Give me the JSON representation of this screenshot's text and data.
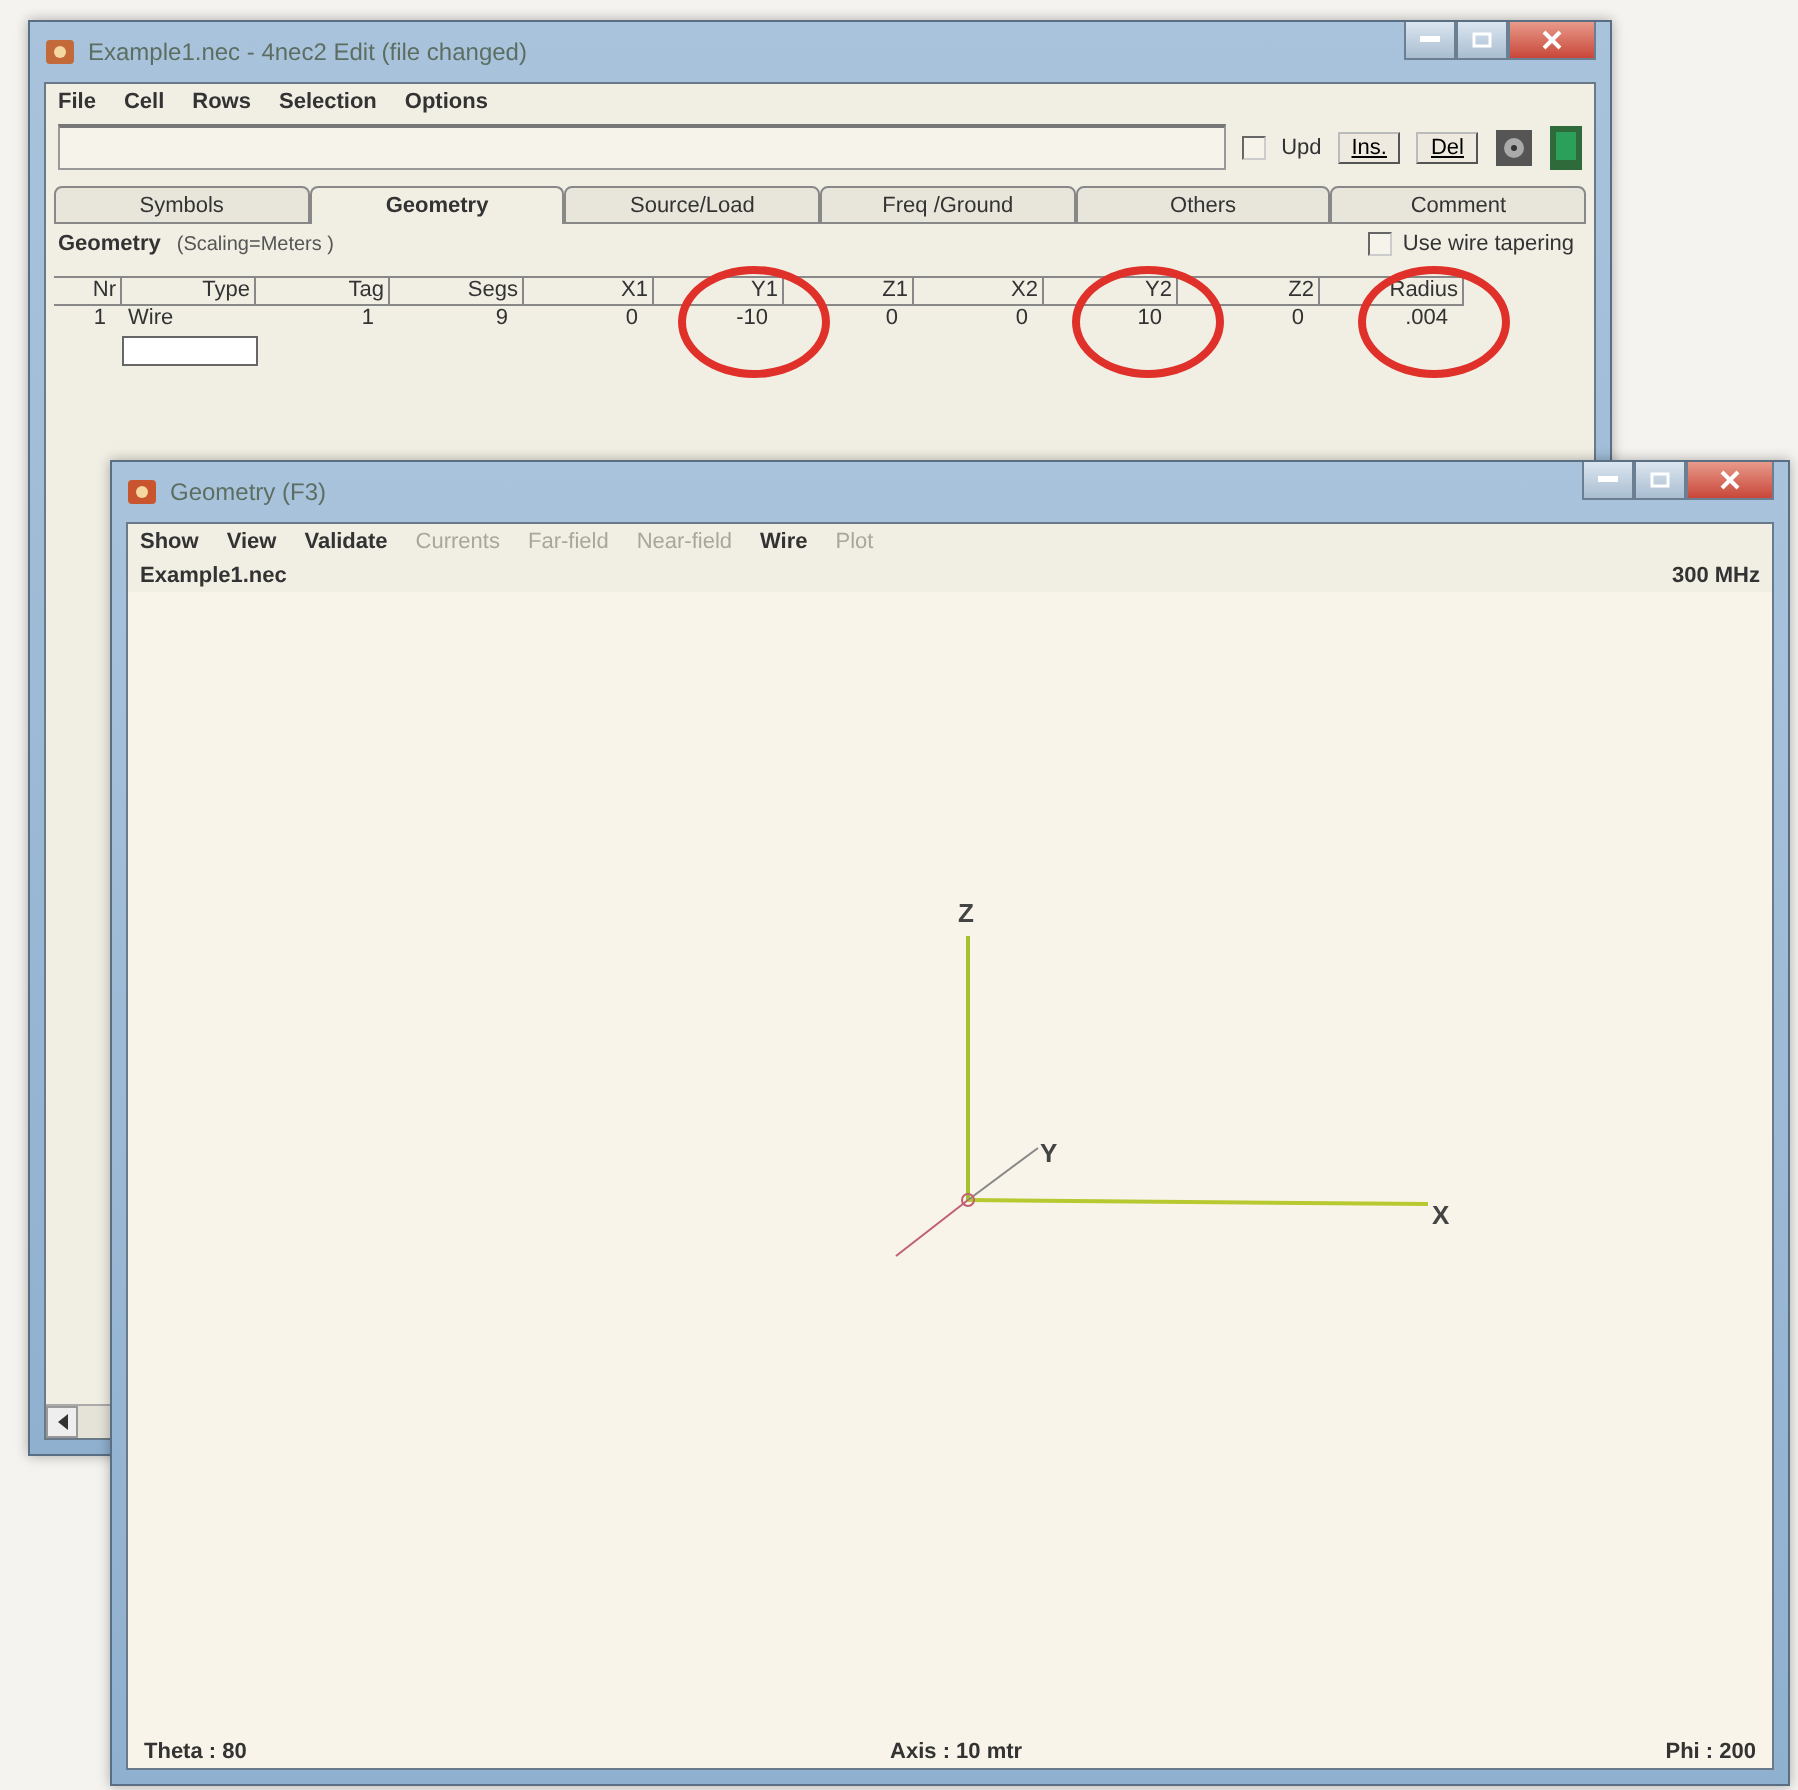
{
  "editor_window": {
    "title": "Example1.nec - 4nec2 Edit (file changed)",
    "menu": [
      "File",
      "Cell",
      "Rows",
      "Selection",
      "Options"
    ],
    "toolbar": {
      "upd": {
        "label": "Upd",
        "checked": false
      },
      "buttons": [
        "Ins.",
        "Del"
      ]
    },
    "tabs": [
      {
        "label": "Symbols",
        "selected": false
      },
      {
        "label": "Geometry",
        "selected": true
      },
      {
        "label": "Source/Load",
        "selected": false
      },
      {
        "label": "Freq /Ground",
        "selected": false
      },
      {
        "label": "Others",
        "selected": false
      },
      {
        "label": "Comment",
        "selected": false
      }
    ],
    "section": {
      "title": "Geometry",
      "subtitle": "(Scaling=Meters )",
      "tapering": {
        "label": "Use wire tapering",
        "checked": false
      }
    },
    "table": {
      "columns": [
        {
          "label": "Nr",
          "circled": false
        },
        {
          "label": "Type",
          "circled": false
        },
        {
          "label": "Tag",
          "circled": false
        },
        {
          "label": "Segs",
          "circled": false
        },
        {
          "label": "X1",
          "circled": false
        },
        {
          "label": "Y1",
          "circled": true
        },
        {
          "label": "Z1",
          "circled": false
        },
        {
          "label": "X2",
          "circled": false
        },
        {
          "label": "Y2",
          "circled": true
        },
        {
          "label": "Z2",
          "circled": false
        },
        {
          "label": "Radius",
          "circled": true
        }
      ],
      "rows": [
        [
          "1",
          "Wire",
          "1",
          "9",
          "0",
          "-10",
          "0",
          "0",
          "10",
          "0",
          ".004"
        ]
      ]
    }
  },
  "geometry_window": {
    "title": "Geometry (F3)",
    "menu": [
      {
        "label": "Show",
        "disabled": false
      },
      {
        "label": "View",
        "disabled": false
      },
      {
        "label": "Validate",
        "disabled": false
      },
      {
        "label": "Currents",
        "disabled": true
      },
      {
        "label": "Far-field",
        "disabled": true
      },
      {
        "label": "Near-field",
        "disabled": true
      },
      {
        "label": "Wire",
        "disabled": false
      },
      {
        "label": "Plot",
        "disabled": true
      }
    ],
    "file": "Example1.nec",
    "frequency": "300 MHz",
    "axes": [
      {
        "label": "Z"
      },
      {
        "label": "Y"
      },
      {
        "label": "X"
      }
    ],
    "status": {
      "theta": "Theta : 80",
      "axis": "Axis : 10 mtr",
      "phi": "Phi : 200"
    }
  }
}
